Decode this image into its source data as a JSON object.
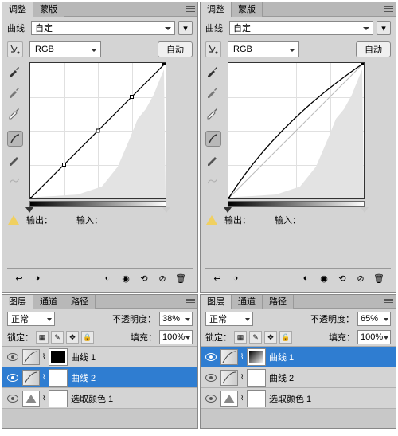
{
  "left": {
    "adjustments": {
      "tab1": "调整",
      "tab2": "蒙版",
      "preset_label": "曲线",
      "preset_value": "自定",
      "channel": "RGB",
      "auto_btn": "自动",
      "output_label": "输出：",
      "input_label": "输入："
    },
    "layers": {
      "tab1": "图层",
      "tab2": "通道",
      "tab3": "路径",
      "blend_mode": "正常",
      "opacity_label": "不透明度：",
      "opacity_value": "38%",
      "lock_label": "锁定：",
      "fill_label": "填充：",
      "fill_value": "100%",
      "layer1": "曲线 1",
      "layer2": "曲线 2",
      "layer3": "选取颜色 1"
    }
  },
  "right": {
    "adjustments": {
      "tab1": "调整",
      "tab2": "蒙版",
      "preset_label": "曲线",
      "preset_value": "自定",
      "channel": "RGB",
      "auto_btn": "自动",
      "output_label": "输出：",
      "input_label": "输入："
    },
    "layers": {
      "tab1": "图层",
      "tab2": "通道",
      "tab3": "路径",
      "blend_mode": "正常",
      "opacity_label": "不透明度：",
      "opacity_value": "65%",
      "lock_label": "锁定：",
      "fill_label": "填充：",
      "fill_value": "100%",
      "layer1": "曲线 1",
      "layer2": "曲线 2",
      "layer3": "选取颜色 1"
    }
  },
  "chart_data": [
    {
      "type": "line",
      "title": "Curves (left) – linear",
      "xlabel": "Input",
      "ylabel": "Output",
      "xlim": [
        0,
        255
      ],
      "ylim": [
        0,
        255
      ],
      "series": [
        {
          "name": "RGB",
          "x": [
            0,
            64,
            128,
            192,
            255
          ],
          "y": [
            0,
            64,
            128,
            192,
            255
          ]
        }
      ]
    },
    {
      "type": "line",
      "title": "Curves (right) – lightened midtones",
      "xlabel": "Input",
      "ylabel": "Output",
      "xlim": [
        0,
        255
      ],
      "ylim": [
        0,
        255
      ],
      "series": [
        {
          "name": "RGB",
          "x": [
            0,
            64,
            128,
            192,
            255
          ],
          "y": [
            0,
            105,
            175,
            225,
            255
          ]
        }
      ]
    }
  ]
}
